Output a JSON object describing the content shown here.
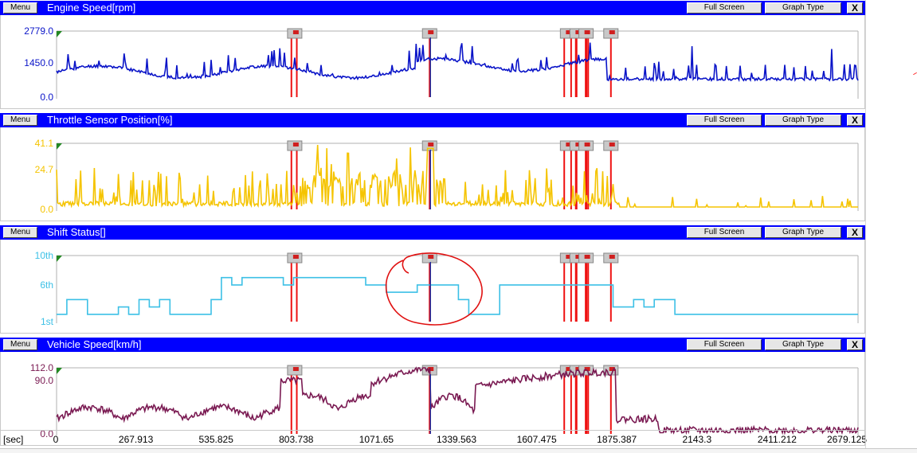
{
  "buttons": {
    "menu": "Menu",
    "full_screen": "Full Screen",
    "graph_type": "Graph Type",
    "close": "X"
  },
  "panels": [
    {
      "title": "Engine Speed[rpm]",
      "color": "#0a14c8",
      "y_ticks": [
        "2779.0",
        "1450.0",
        "0.0"
      ],
      "ymin": 0,
      "ymax": 2779.0,
      "mid": 1450.0,
      "profile": "engine"
    },
    {
      "title": "Throttle Sensor Position[%]",
      "color": "#f5c400",
      "y_ticks": [
        "41.1",
        "24.7",
        "0.0"
      ],
      "ymin": 0,
      "ymax": 41.1,
      "mid": 24.7,
      "profile": "throttle"
    },
    {
      "title": "Shift Status[]",
      "color": "#3cc0e6",
      "y_ticks": [
        "10th",
        "6th",
        "1st"
      ],
      "ymin": 1,
      "ymax": 10,
      "mid": 6,
      "profile": "shift"
    },
    {
      "title": "Vehicle Speed[km/h]",
      "color": "#7a1a52",
      "y_ticks": [
        "112.0",
        "90.0",
        "0.0"
      ],
      "ymin": 0,
      "ymax": 112.0,
      "mid": 90.0,
      "profile": "speed"
    }
  ],
  "x_axis": {
    "unit": "[sec]",
    "ticks": [
      "0",
      "267.913",
      "535.825",
      "803.738",
      "1071.65",
      "1339.563",
      "1607.475",
      "1875.387",
      "2143.3",
      "2411.212",
      "2679.125"
    ],
    "xmin": 0,
    "xmax": 2679.125
  },
  "markers_sec": [
    785,
    803,
    1247,
    1697,
    1720,
    1737,
    1770,
    1777,
    1853
  ],
  "marker_color": "#ee1111",
  "annotation_color": "#e01010"
}
